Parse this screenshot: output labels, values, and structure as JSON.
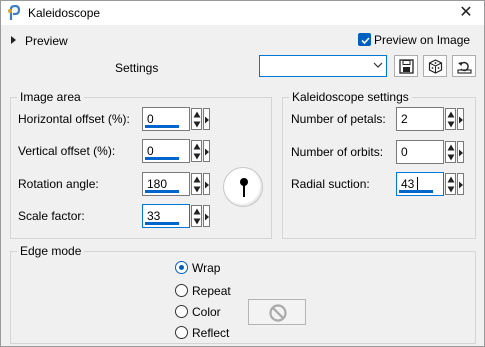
{
  "window": {
    "title": "Kaleidoscope"
  },
  "preview": {
    "label": "Preview"
  },
  "preview_on_image": {
    "label": "Preview on Image",
    "checked": true
  },
  "settings": {
    "label": "Settings",
    "value": ""
  },
  "image_area": {
    "title": "Image area",
    "horizontal_offset": {
      "label": "Horizontal offset (%):",
      "value": "0"
    },
    "vertical_offset": {
      "label": "Vertical offset (%):",
      "value": "0"
    },
    "rotation_angle": {
      "label": "Rotation angle:",
      "value": "180"
    },
    "scale_factor": {
      "label": "Scale factor:",
      "value": "33"
    }
  },
  "kaleidoscope_settings": {
    "title": "Kaleidoscope settings",
    "number_of_petals": {
      "label": "Number of petals:",
      "value": "2"
    },
    "number_of_orbits": {
      "label": "Number of orbits:",
      "value": "0"
    },
    "radial_suction": {
      "label": "Radial suction:",
      "value": "43"
    }
  },
  "edge_mode": {
    "title": "Edge mode",
    "options": [
      {
        "label": "Wrap",
        "selected": true
      },
      {
        "label": "Repeat",
        "selected": false
      },
      {
        "label": "Color",
        "selected": false
      },
      {
        "label": "Reflect",
        "selected": false
      }
    ]
  },
  "colors": {
    "accent": "#0060c0",
    "underline": "#0066cc",
    "dialog_bg": "#f0f0f0"
  }
}
